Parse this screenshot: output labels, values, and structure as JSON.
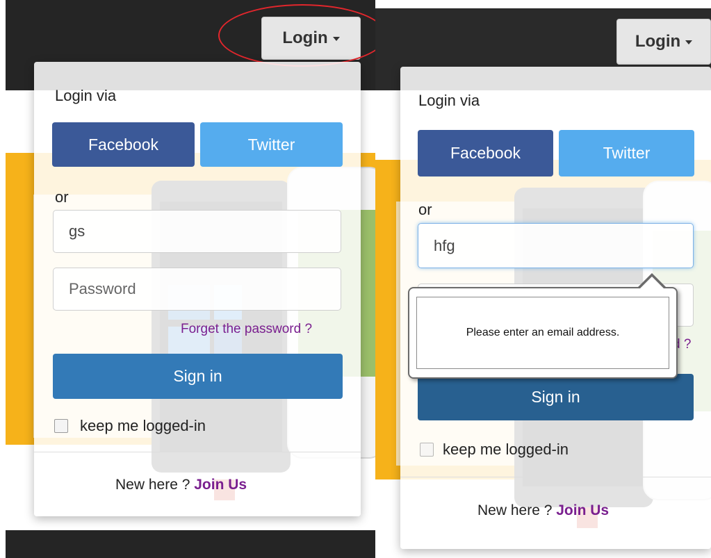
{
  "left_panel": {
    "login_toggle": {
      "label": "Login"
    },
    "dropdown": {
      "login_via": "Login via",
      "facebook": "Facebook",
      "twitter": "Twitter",
      "or": "or",
      "email_value": "gs",
      "password_placeholder": "Password",
      "forgot": "Forget the password ?",
      "signin": "Sign in",
      "keep_logged": "keep me logged-in",
      "new_here": "New here ?",
      "join": "Join Us"
    }
  },
  "right_panel": {
    "login_toggle": {
      "label": "Login"
    },
    "dropdown": {
      "login_via": "Login via",
      "facebook": "Facebook",
      "twitter": "Twitter",
      "or": "or",
      "email_value": "hfg",
      "forgot_partial": "d ?",
      "signin": "Sign in",
      "keep_logged": "keep me logged-in",
      "new_here": "New here ?",
      "join": "Join Us"
    },
    "validation_tooltip": {
      "message": "Please enter an email address."
    }
  },
  "colors": {
    "facebook": "#3b5998",
    "twitter": "#55acee",
    "primary": "#337ab7",
    "link_purple": "#7a1f8f",
    "highlight_red": "#e2262c",
    "dark_bar": "#252525",
    "promo_yellow": "#f6b21a"
  },
  "icons": [
    "caret-down-icon",
    "checkbox-icon"
  ]
}
